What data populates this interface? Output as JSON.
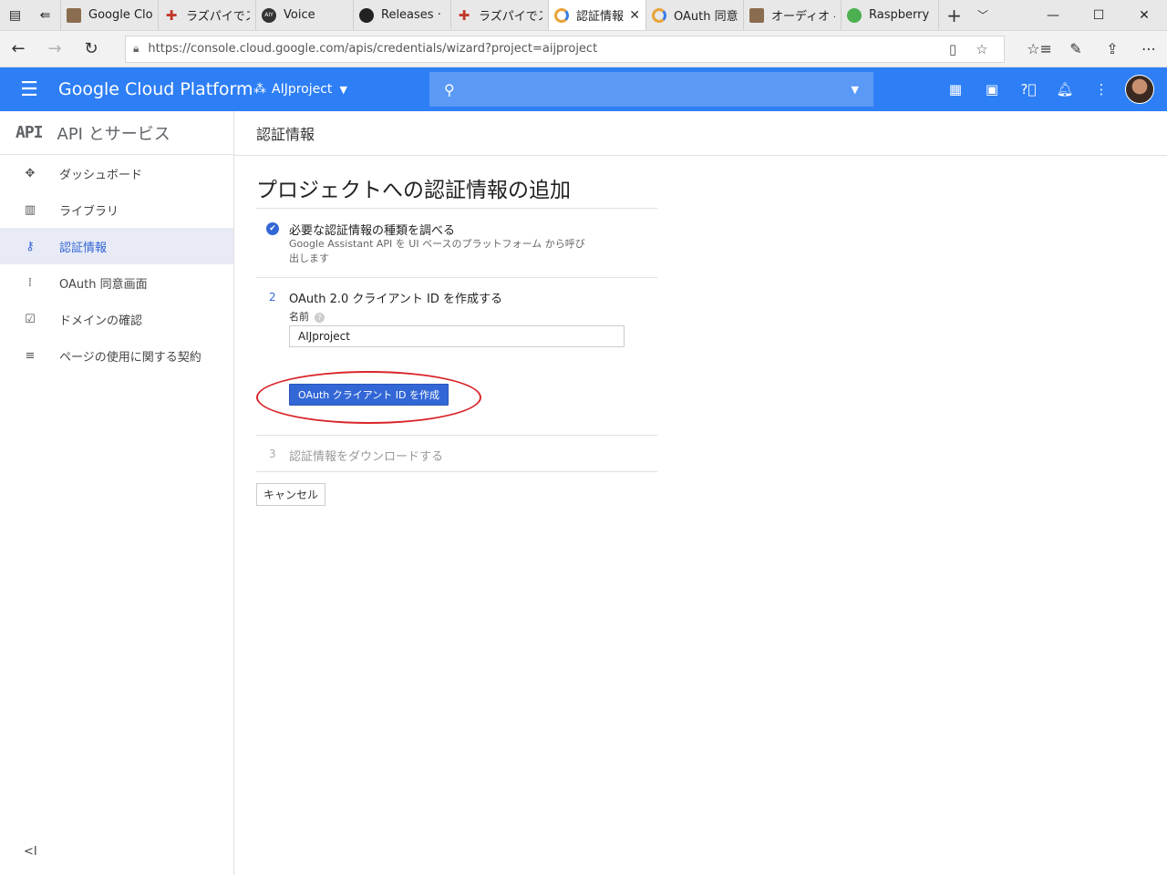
{
  "browser": {
    "tabs": [
      {
        "label": "Google Clo",
        "favicon": "gcp-avatar-favicon",
        "color": "#8a6d4e"
      },
      {
        "label": "ラズパイでスマ",
        "favicon": "raspi-cross-favicon",
        "color": "#c0392b"
      },
      {
        "label": "Voice",
        "favicon": "aiy-favicon",
        "color": "#333333"
      },
      {
        "label": "Releases · g",
        "favicon": "github-favicon",
        "color": "#222222"
      },
      {
        "label": "ラズパイでスマ",
        "favicon": "raspi-cross-favicon",
        "color": "#c0392b"
      },
      {
        "label": "認証情報",
        "favicon": "gcp-hex-favicon",
        "color": "#e8a33a",
        "active": true
      },
      {
        "label": "OAuth 同意",
        "favicon": "gcp-hex-favicon",
        "color": "#e8a33a"
      },
      {
        "label": "オーディオ - F",
        "favicon": "gcp-avatar-favicon",
        "color": "#8a6d4e"
      },
      {
        "label": "Raspberry P",
        "favicon": "raspberry-favicon",
        "color": "#4caf50"
      }
    ],
    "url": "https://console.cloud.google.com/apis/credentials/wizard?project=aijproject"
  },
  "header": {
    "brand": "Google Cloud Platform",
    "project": "AIJproject"
  },
  "sidebar": {
    "logo": "API",
    "title": "API とサービス",
    "items": [
      {
        "label": "ダッシュボード",
        "icon": "dashboard-icon"
      },
      {
        "label": "ライブラリ",
        "icon": "library-icon"
      },
      {
        "label": "認証情報",
        "icon": "key-icon",
        "active": true
      },
      {
        "label": "OAuth 同意画面",
        "icon": "consent-icon"
      },
      {
        "label": "ドメインの確認",
        "icon": "domain-check-icon"
      },
      {
        "label": "ページの使用に関する契約",
        "icon": "page-settings-icon"
      }
    ]
  },
  "page": {
    "header_title": "認証情報",
    "heading": "プロジェクトへの認証情報の追加",
    "step1": {
      "title": "必要な認証情報の種類を調べる",
      "desc_line1": "Google Assistant API を UI ベースのプラットフォーム から呼び",
      "desc_line2": "出します"
    },
    "step2": {
      "num": "2",
      "title": "OAuth 2.0 クライアント ID を作成する",
      "field_label": "名前",
      "field_value": "AIJproject",
      "button_label": "OAuth クライアント ID を作成"
    },
    "step3": {
      "num": "3",
      "title": "認証情報をダウンロードする"
    },
    "cancel_label": "キャンセル"
  }
}
